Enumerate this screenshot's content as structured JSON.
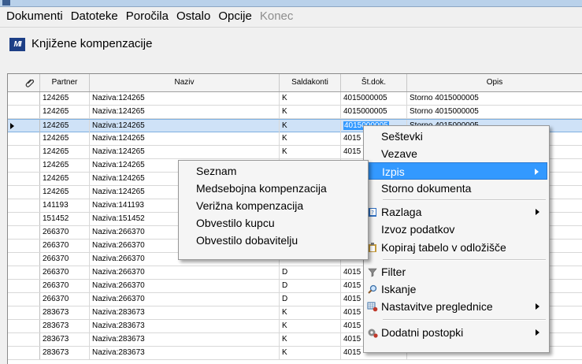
{
  "menubar": {
    "items": [
      "Dokumenti",
      "Datoteke",
      "Poročila",
      "Ostalo",
      "Opcije",
      "Konec"
    ]
  },
  "window": {
    "title": "Knjižene kompenzacije",
    "logo": "MI"
  },
  "grid": {
    "columns": [
      "Partner",
      "Naziv",
      "Saldakonti",
      "Št.dok.",
      "Opis"
    ],
    "rows": [
      [
        "124265",
        "Naziva:124265",
        "K",
        "4015000005",
        "Storno 4015000005"
      ],
      [
        "124265",
        "Naziva:124265",
        "K",
        "4015000005",
        "Storno 4015000005"
      ],
      [
        "124265",
        "Naziva:124265",
        "K",
        "4015000005",
        "Storno 4015000005"
      ],
      [
        "124265",
        "Naziva:124265",
        "K",
        "4015",
        ""
      ],
      [
        "124265",
        "Naziva:124265",
        "K",
        "4015",
        ""
      ],
      [
        "124265",
        "Naziva:124265",
        "",
        "",
        ""
      ],
      [
        "124265",
        "Naziva:124265",
        "",
        "",
        ""
      ],
      [
        "124265",
        "Naziva:124265",
        "",
        "",
        ""
      ],
      [
        "141193",
        "Naziva:141193",
        "",
        "",
        ""
      ],
      [
        "151452",
        "Naziva:151452",
        "",
        "",
        ""
      ],
      [
        "266370",
        "Naziva:266370",
        "",
        "",
        ""
      ],
      [
        "266370",
        "Naziva:266370",
        "",
        "",
        ""
      ],
      [
        "266370",
        "Naziva:266370",
        "",
        "",
        ""
      ],
      [
        "266370",
        "Naziva:266370",
        "D",
        "4015",
        ""
      ],
      [
        "266370",
        "Naziva:266370",
        "D",
        "4015",
        ""
      ],
      [
        "266370",
        "Naziva:266370",
        "D",
        "4015",
        ""
      ],
      [
        "283673",
        "Naziva:283673",
        "K",
        "4015",
        ""
      ],
      [
        "283673",
        "Naziva:283673",
        "K",
        "4015",
        ""
      ],
      [
        "283673",
        "Naziva:283673",
        "K",
        "4015",
        ""
      ],
      [
        "283673",
        "Naziva:283673",
        "K",
        "4015",
        ""
      ]
    ]
  },
  "context_menu": {
    "items": [
      {
        "label": "Seštevki",
        "icon": "",
        "submenu": false
      },
      {
        "label": "Vezave",
        "icon": "",
        "submenu": false
      },
      {
        "label": "Izpis",
        "icon": "",
        "submenu": true
      },
      {
        "label": "Storno dokumenta",
        "icon": "",
        "submenu": false
      },
      {
        "label": "Razlaga",
        "icon": "help-book-icon",
        "submenu": true
      },
      {
        "label": "Izvoz podatkov",
        "icon": "",
        "submenu": false
      },
      {
        "label": "Kopiraj tabelo v odložišče",
        "icon": "clipboard-icon",
        "submenu": false
      },
      {
        "label": "Filter",
        "icon": "funnel-icon",
        "submenu": false
      },
      {
        "label": "Iskanje",
        "icon": "magnifier-icon",
        "submenu": false
      },
      {
        "label": "Nastavitve preglednice",
        "icon": "grid-settings-icon",
        "submenu": true
      },
      {
        "label": "Dodatni postopki",
        "icon": "gear-icon",
        "submenu": true
      }
    ]
  },
  "print_submenu": {
    "items": [
      "Seznam",
      "Medsebojna kompenzacija",
      "Verižna kompenzacija",
      "Obvestilo kupcu",
      "Obvestilo dobavitelju"
    ]
  },
  "colors": {
    "highlight": "#3399ff",
    "selected_row": "#cfe2f7",
    "logo": "#1d3f86"
  }
}
